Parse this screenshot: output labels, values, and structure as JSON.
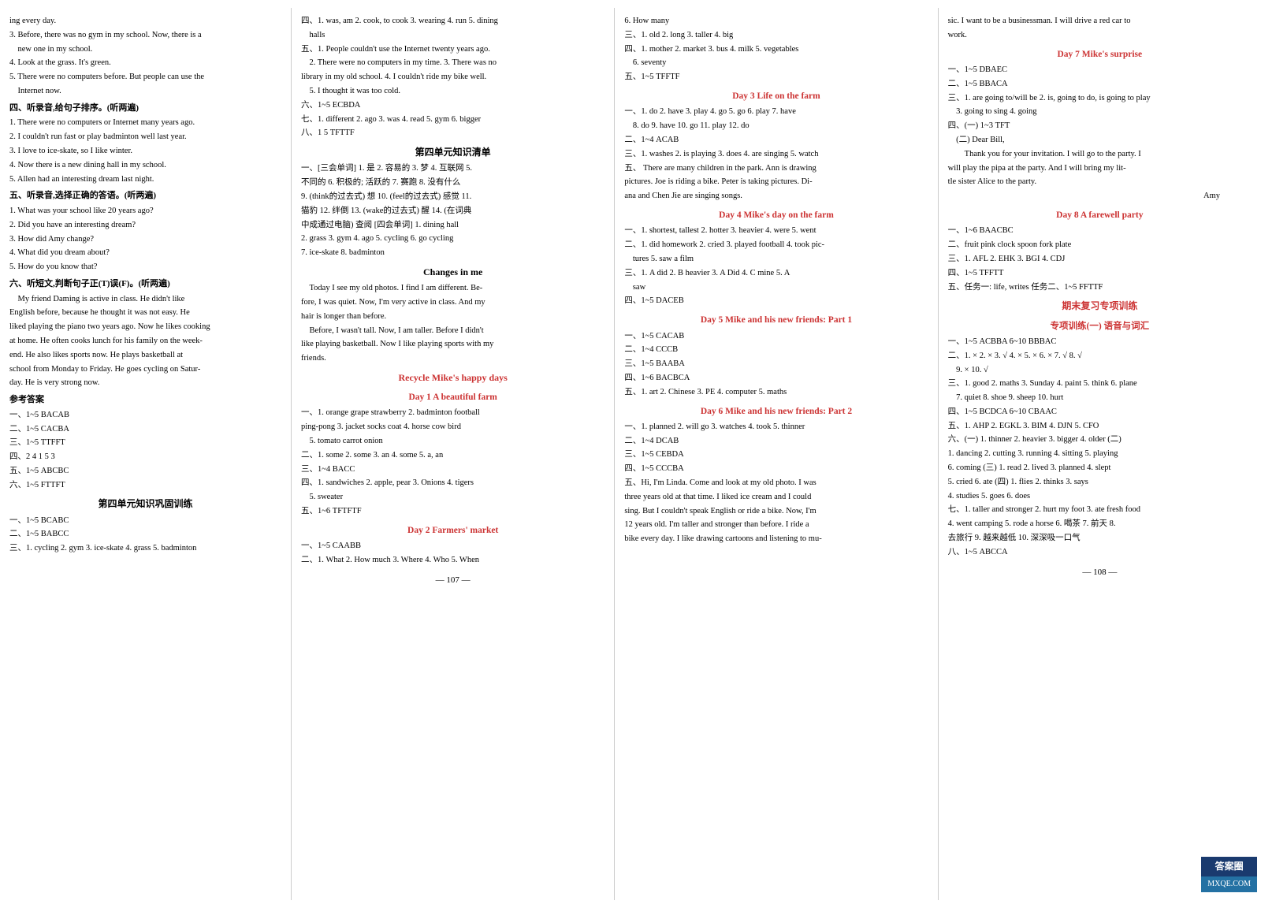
{
  "page": {
    "left_column": {
      "lines": [
        "ing every day.",
        "3. Before, there was no gym in my school. Now, there is a",
        "new one in my school.",
        "4. Look at the grass. It's green.",
        "5. There were no computers before. But people can use the",
        "Internet now.",
        "四、听录音,给句子排序。(听两遍)",
        "1. There were no computers or Internet many years ago.",
        "2. I couldn't run fast or play badminton well last year.",
        "3. I love to ice-skate, so I like winter.",
        "4. Now there is a new dining hall in my school.",
        "5. Allen had an interesting dream last night.",
        "五、听录音,选择正确的答语。(听两遍)",
        "1. What was your school like 20 years ago?",
        "2. Did you have an interesting dream?",
        "3. How did Amy change?",
        "4. What did you dream about?",
        "5. How do you know that?",
        "六、听短文,判断句子正(T)误(F)。(听两遍)",
        "My friend Daming is active in class. He didn't like",
        "English before, because he thought it was not easy. He",
        "liked playing the piano two years ago. Now he likes cooking",
        "at home. He often cooks lunch for his family on the week-",
        "end. He also likes sports now. He plays basketball at",
        "school from Monday to Friday. He goes cycling on Satur-",
        "day. He is very strong now.",
        "参考答案",
        "一、1~5  BACAB",
        "二、1~5  CACBA",
        "三、1~5  TTFFT",
        "四、2  4  1  5  3",
        "五、1~5  ABCBC",
        "六、1~5  FTTFT",
        "第四单元知识巩固训练",
        "一、1~5  BCABC",
        "二、1~5  BABCC",
        "三、1. cycling  2. gym  3. ice-skate  4. grass  5. badminton"
      ]
    },
    "middle_column": {
      "section1_lines": [
        "四、1. was, am  2. cook, to cook  3. wearing  4. run  5. dining",
        "halls",
        "五、1. People couldn't use the Internet twenty years ago.",
        "2. There were no computers in my time.  3. There was no",
        "library in my old school.  4. I couldn't ride my bike well.",
        "5. I thought it was too cold.",
        "六、1~5  ECBDA",
        "七、1. different  2. ago  3. was  4. read  5. gym  6. bigger",
        "八、1  5  TFTTF",
        "第四单元知识清单",
        "一、[三会单词] 1. 是  2. 容易的  3. 梦  4. 互联网  5.",
        "不同的  6. 积极的; 活跃的  7. 赛跑  8. 没有什么",
        "9. (think的过去式) 想  10. (feel的过去式) 感觉  11.",
        "猫豹  12. 绊倒  13. (wake的过去式) 醒  14. (在词典",
        "中成通过电脑) 查阅  [四会单词] 1. dining hall",
        "2. grass  3. gym  4. ago  5. cycling  6. go cycling",
        "7. ice-skate  8. badminton",
        "Changes in me",
        "Today I see my old photos. I find I am different. Be-",
        "fore, I was quiet. Now, I'm very active in class. And my",
        "hair is longer than before.",
        "Before, I wasn't tall. Now, I am taller. Before I didn't",
        "like playing basketball. Now I like playing sports with my",
        "friends.",
        "Recycle  Mike's happy days",
        "Day 1  A beautiful farm",
        "一、1. orange  grape  strawberry  2. badminton  football",
        "ping-pong  3. jacket  socks  coat  4. horse  cow  bird",
        "5. tomato  carrot  onion",
        "二、1. some  2. some  3. an  4. some  5. a, an",
        "三、1~4  BACC",
        "四、1. sandwiches  2. apple, pear  3. Onions  4. tigers",
        "5. sweater",
        "五、1~6  TFTFTF",
        "Day 2  Farmers' market",
        "一、1~5  CAABB",
        "二、1. What  2. How much  3. Where  4. Who  5. When"
      ],
      "page_num": "— 107 —"
    },
    "right_upper_column": {
      "lines": [
        "6. How many",
        "三、1. old  2. long  3. taller  4. big",
        "四、1. mother  2. market  3. bus  4. milk  5. vegetables",
        "6. seventy",
        "五、1~5  TFFTF",
        "Day 3  Life on the farm",
        "一、1. do  2. have  3. play  4. go  5. go  6. play  7. have",
        "8. do  9. have  10. go  11. play  12. do",
        "二、1~4  ACAB",
        "三、1. washes  2. is playing  3. does  4. are singing  5. watch",
        "五、There are many children in the park. Ann is drawing",
        "pictures. Joe is riding a bike. Peter is taking pictures. Di-",
        "ana and Chen Jie are singing songs.",
        "Day 4  Mike's day on the farm",
        "一、1. shortest, tallest  2. hotter  3. heavier  4. were  5. went",
        "二、1. did homework  2. cried  3. played football  4. took pic-",
        "tures  5. saw a film",
        "三、1. A  did  2. B  heavier  3. A  Did  4. C  mine  5. A",
        "saw",
        "四、1~5  DACEB",
        "Day 5  Mike and his new friends: Part 1",
        "一、1~5  CACAB",
        "二、1~4  CCCB",
        "三、1~5  BAABA",
        "四、1~6  BACBCA",
        "五、1. art  2. Chinese  3. PE  4. computer  5. maths",
        "Day 6  Mike and his new friends: Part 2",
        "一、1. planned  2. will go  3. watches  4. took  5. thinner",
        "二、1~4  DCAB",
        "三、1~5  CEBDA",
        "四、1~5  CCCBA",
        "五、Hi, I'm Linda. Come and look at my old photo. I was",
        "three years old at that time. I liked ice cream and I could",
        "sing. But I couldn't speak English or ride a bike. Now, I'm",
        "12 years old. I'm taller and stronger than before. I ride a",
        "bike every day. I like drawing cartoons and listening to mu-"
      ]
    },
    "right_lower_column": {
      "lines": [
        "sic. I want to be a businessman. I will drive a red car to",
        "work.",
        "Day 7  Mike's surprise",
        "一、1~5  DBAEC",
        "二、1~5  BBACA",
        "三、1. are going to/will be  2. is, going to do, is going to play",
        "3. going to sing  4. going",
        "四、(一) 1~3  TFT",
        "(二) Dear Bill,",
        "Thank you for your invitation. I will go to the party. I",
        "will play the pipa at the party. And I will bring my lit-",
        "tle sister Alice to the party.",
        "Amy",
        "Day 8  A farewell party",
        "一、1~6  BAACBC",
        "二、fruit  pink  clock  spoon  fork  plate",
        "三、1. AFL  2. EHK  3. BGI  4. CDJ",
        "四、1~5  TFFTT",
        "五、任务一: life, writes  任务二、1~5  FFTTF",
        "期末复习专项训练",
        "专项训练(一)  语音与词汇",
        "一、1~5  ACBBA  6~10  BBBAC",
        "二、1. ×  2. ×  3. √  4. ×  5. ×  6. ×  7. √  8. √",
        "9. ×  10. √",
        "三、1. good  2. maths  3. Sunday  4. paint  5. think  6. plane",
        "7. quiet  8. shoe  9. sheep  10. hurt",
        "四、1~5  BCDCA  6~10  CBAAC",
        "五、1. AHP  2. EGKL  3. BIM  4. DJN  5. CFO",
        "六、(一) 1. thinner  2. heavier  3. bigger  4. older  (二)",
        "1. dancing  2. cutting  3. running  4. sitting  5. playing",
        "6. coming  (三) 1. read  2. lived  3. planned  4. slept",
        "5. cried  6. ate  (四) 1. flies  2. thinks  3. says",
        "4. studies  5. goes  6. does",
        "七、1. taller and stronger  2. hurt my foot  3. ate fresh food",
        "4. went camping  5. rode a horse  6. 喝茶  7. 前天  8.",
        "去旅行  9. 越来越低  10. 深深吸一口气",
        "八、1~5  ABCCA"
      ],
      "page_num": "— 108 —"
    },
    "watermark": {
      "line1": "答案圈",
      "line2": "MXQE.COM"
    }
  }
}
